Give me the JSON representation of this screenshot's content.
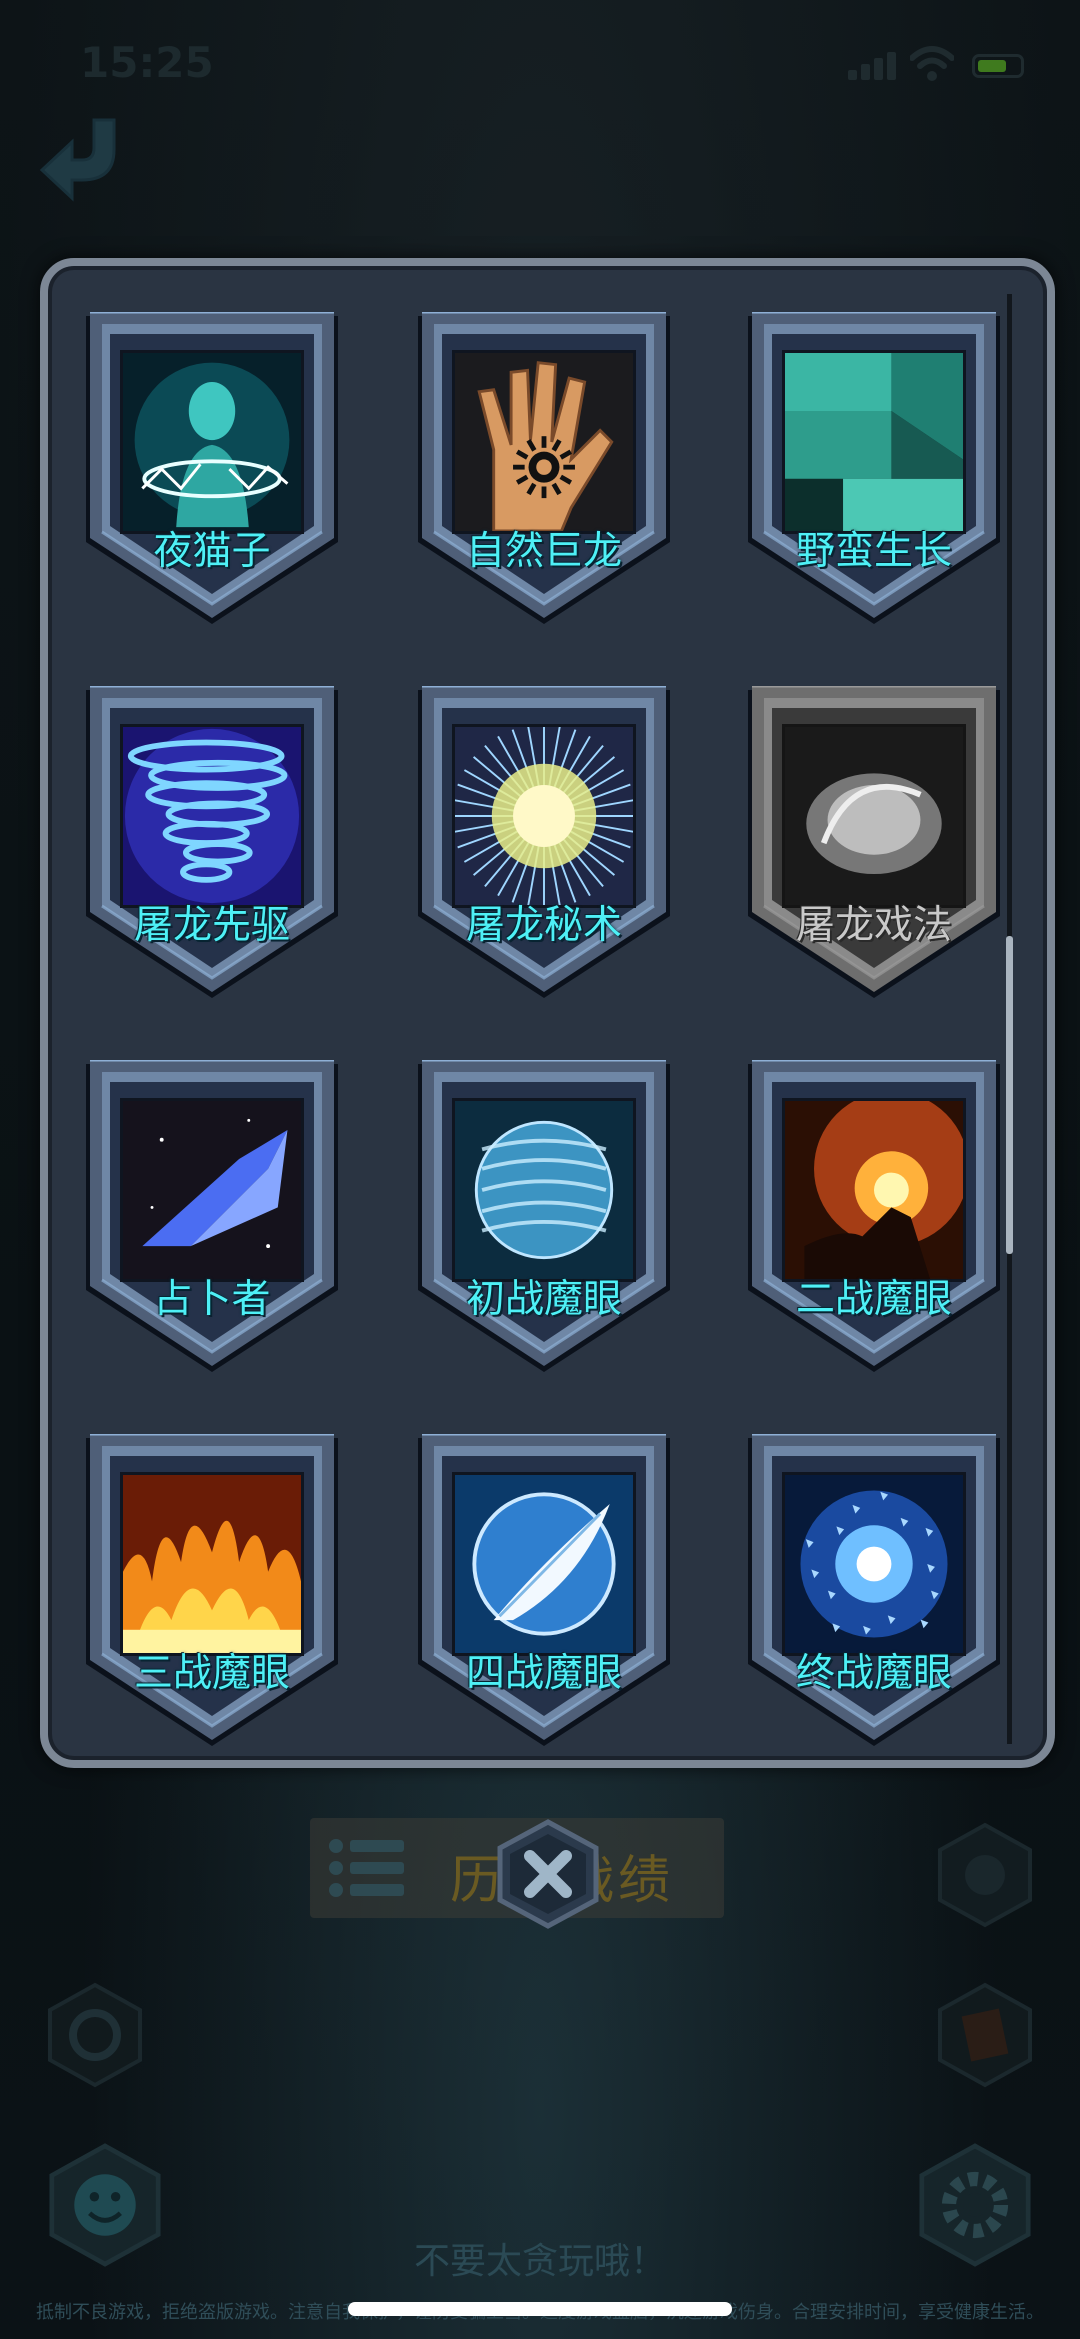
{
  "status_bar": {
    "time": "15:25"
  },
  "panel": {
    "items": [
      {
        "label": "夜猫子",
        "art": "ghost-lightning",
        "locked": false
      },
      {
        "label": "自然巨龙",
        "art": "hand-sun",
        "locked": false
      },
      {
        "label": "野蛮生长",
        "art": "stone-blocks",
        "locked": false
      },
      {
        "label": "屠龙先驱",
        "art": "tornado",
        "locked": false
      },
      {
        "label": "屠龙秘术",
        "art": "light-burst",
        "locked": false
      },
      {
        "label": "屠龙戏法",
        "art": "smoke",
        "locked": true
      },
      {
        "label": "占卜者",
        "art": "crystal",
        "locked": false
      },
      {
        "label": "初战魔眼",
        "art": "water-orb",
        "locked": false
      },
      {
        "label": "二战魔眼",
        "art": "fire-hand",
        "locked": false
      },
      {
        "label": "三战魔眼",
        "art": "flames",
        "locked": false
      },
      {
        "label": "四战魔眼",
        "art": "feather-orb",
        "locked": false
      },
      {
        "label": "终战魔眼",
        "art": "ice-shatter",
        "locked": false
      }
    ]
  },
  "history_button": {
    "label": "历史战绩"
  },
  "bottom": {
    "hint": "不要太贪玩哦！",
    "notice": "抵制不良游戏，拒绝盗版游戏。注意自我保护，谨防受骗上当。适度游戏益脑，沉迷游戏伤身。合理安排时间，享受健康生活。"
  },
  "icons": {
    "back": "back-arrow-icon",
    "close": "close-icon",
    "history": "list-icon",
    "settings": "gear-icon",
    "emoji": "smile-icon"
  },
  "colors": {
    "label": "#4ef0f6",
    "panel_bg": "#2a3442",
    "panel_border": "#7c8795"
  }
}
